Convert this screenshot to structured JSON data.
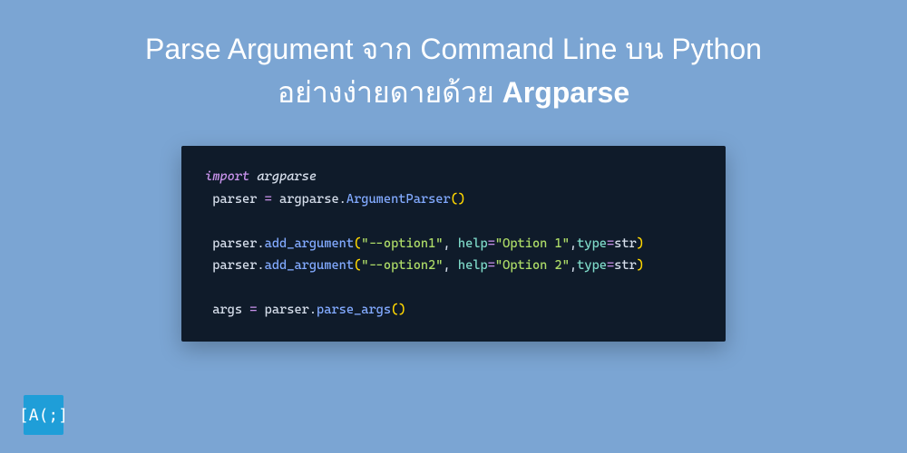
{
  "title": {
    "line1": "Parse Argument จาก Command Line บน Python",
    "line2_prefix": "อย่างง่ายดายด้วย ",
    "line2_bold": "Argparse"
  },
  "code": {
    "l1_import": "import",
    "l1_mod": " argparse",
    "l2_pre": " parser ",
    "l2_eq": "=",
    "l2_obj": " argparse",
    "l2_dot": ".",
    "l2_call": "ArgumentParser",
    "l2_p1": "(",
    "l2_p2": ")",
    "l3_pre": " parser",
    "l3_dot": ".",
    "l3_call": "add_argument",
    "l3_p1": "(",
    "l3_s1": "\"--option1\"",
    "l3_c1": ", ",
    "l3_kw1": "help",
    "l3_eq1": "=",
    "l3_s2": "\"Option 1\"",
    "l3_c2": ",",
    "l3_kw2": "type",
    "l3_eq2": "=",
    "l3_t": "str",
    "l3_p2": ")",
    "l4_pre": " parser",
    "l4_dot": ".",
    "l4_call": "add_argument",
    "l4_p1": "(",
    "l4_s1": "\"--option2\"",
    "l4_c1": ", ",
    "l4_kw1": "help",
    "l4_eq1": "=",
    "l4_s2": "\"Option 2\"",
    "l4_c2": ",",
    "l4_kw2": "type",
    "l4_eq2": "=",
    "l4_t": "str",
    "l4_p2": ")",
    "l5_pre": " args ",
    "l5_eq": "=",
    "l5_obj": " parser",
    "l5_dot": ".",
    "l5_call": "parse_args",
    "l5_p1": "(",
    "l5_p2": ")"
  },
  "logo": {
    "text": "[A(;]"
  }
}
